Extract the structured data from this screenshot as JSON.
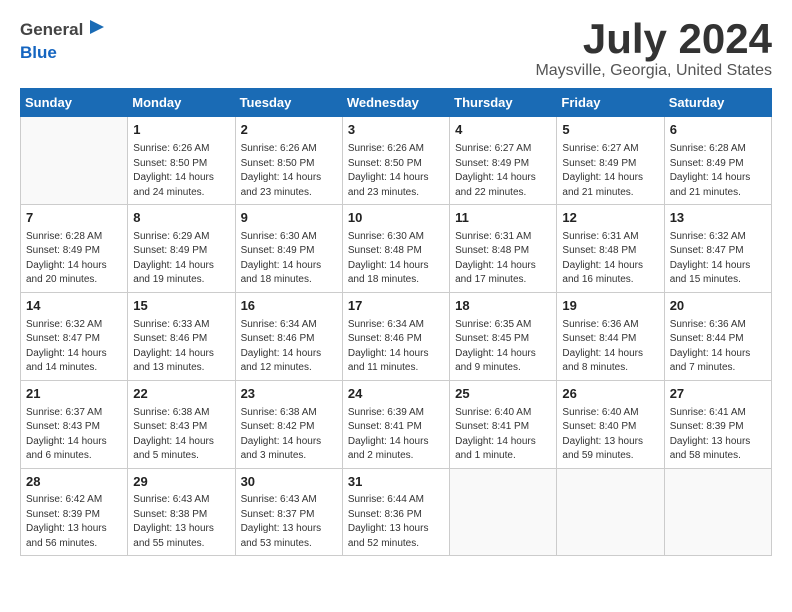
{
  "header": {
    "logo_line1": "General",
    "logo_line2": "Blue",
    "month": "July 2024",
    "location": "Maysville, Georgia, United States"
  },
  "days_of_week": [
    "Sunday",
    "Monday",
    "Tuesday",
    "Wednesday",
    "Thursday",
    "Friday",
    "Saturday"
  ],
  "weeks": [
    [
      {
        "day": "",
        "info": ""
      },
      {
        "day": "1",
        "info": "Sunrise: 6:26 AM\nSunset: 8:50 PM\nDaylight: 14 hours\nand 24 minutes."
      },
      {
        "day": "2",
        "info": "Sunrise: 6:26 AM\nSunset: 8:50 PM\nDaylight: 14 hours\nand 23 minutes."
      },
      {
        "day": "3",
        "info": "Sunrise: 6:26 AM\nSunset: 8:50 PM\nDaylight: 14 hours\nand 23 minutes."
      },
      {
        "day": "4",
        "info": "Sunrise: 6:27 AM\nSunset: 8:49 PM\nDaylight: 14 hours\nand 22 minutes."
      },
      {
        "day": "5",
        "info": "Sunrise: 6:27 AM\nSunset: 8:49 PM\nDaylight: 14 hours\nand 21 minutes."
      },
      {
        "day": "6",
        "info": "Sunrise: 6:28 AM\nSunset: 8:49 PM\nDaylight: 14 hours\nand 21 minutes."
      }
    ],
    [
      {
        "day": "7",
        "info": "Sunrise: 6:28 AM\nSunset: 8:49 PM\nDaylight: 14 hours\nand 20 minutes."
      },
      {
        "day": "8",
        "info": "Sunrise: 6:29 AM\nSunset: 8:49 PM\nDaylight: 14 hours\nand 19 minutes."
      },
      {
        "day": "9",
        "info": "Sunrise: 6:30 AM\nSunset: 8:49 PM\nDaylight: 14 hours\nand 18 minutes."
      },
      {
        "day": "10",
        "info": "Sunrise: 6:30 AM\nSunset: 8:48 PM\nDaylight: 14 hours\nand 18 minutes."
      },
      {
        "day": "11",
        "info": "Sunrise: 6:31 AM\nSunset: 8:48 PM\nDaylight: 14 hours\nand 17 minutes."
      },
      {
        "day": "12",
        "info": "Sunrise: 6:31 AM\nSunset: 8:48 PM\nDaylight: 14 hours\nand 16 minutes."
      },
      {
        "day": "13",
        "info": "Sunrise: 6:32 AM\nSunset: 8:47 PM\nDaylight: 14 hours\nand 15 minutes."
      }
    ],
    [
      {
        "day": "14",
        "info": "Sunrise: 6:32 AM\nSunset: 8:47 PM\nDaylight: 14 hours\nand 14 minutes."
      },
      {
        "day": "15",
        "info": "Sunrise: 6:33 AM\nSunset: 8:46 PM\nDaylight: 14 hours\nand 13 minutes."
      },
      {
        "day": "16",
        "info": "Sunrise: 6:34 AM\nSunset: 8:46 PM\nDaylight: 14 hours\nand 12 minutes."
      },
      {
        "day": "17",
        "info": "Sunrise: 6:34 AM\nSunset: 8:46 PM\nDaylight: 14 hours\nand 11 minutes."
      },
      {
        "day": "18",
        "info": "Sunrise: 6:35 AM\nSunset: 8:45 PM\nDaylight: 14 hours\nand 9 minutes."
      },
      {
        "day": "19",
        "info": "Sunrise: 6:36 AM\nSunset: 8:44 PM\nDaylight: 14 hours\nand 8 minutes."
      },
      {
        "day": "20",
        "info": "Sunrise: 6:36 AM\nSunset: 8:44 PM\nDaylight: 14 hours\nand 7 minutes."
      }
    ],
    [
      {
        "day": "21",
        "info": "Sunrise: 6:37 AM\nSunset: 8:43 PM\nDaylight: 14 hours\nand 6 minutes."
      },
      {
        "day": "22",
        "info": "Sunrise: 6:38 AM\nSunset: 8:43 PM\nDaylight: 14 hours\nand 5 minutes."
      },
      {
        "day": "23",
        "info": "Sunrise: 6:38 AM\nSunset: 8:42 PM\nDaylight: 14 hours\nand 3 minutes."
      },
      {
        "day": "24",
        "info": "Sunrise: 6:39 AM\nSunset: 8:41 PM\nDaylight: 14 hours\nand 2 minutes."
      },
      {
        "day": "25",
        "info": "Sunrise: 6:40 AM\nSunset: 8:41 PM\nDaylight: 14 hours\nand 1 minute."
      },
      {
        "day": "26",
        "info": "Sunrise: 6:40 AM\nSunset: 8:40 PM\nDaylight: 13 hours\nand 59 minutes."
      },
      {
        "day": "27",
        "info": "Sunrise: 6:41 AM\nSunset: 8:39 PM\nDaylight: 13 hours\nand 58 minutes."
      }
    ],
    [
      {
        "day": "28",
        "info": "Sunrise: 6:42 AM\nSunset: 8:39 PM\nDaylight: 13 hours\nand 56 minutes."
      },
      {
        "day": "29",
        "info": "Sunrise: 6:43 AM\nSunset: 8:38 PM\nDaylight: 13 hours\nand 55 minutes."
      },
      {
        "day": "30",
        "info": "Sunrise: 6:43 AM\nSunset: 8:37 PM\nDaylight: 13 hours\nand 53 minutes."
      },
      {
        "day": "31",
        "info": "Sunrise: 6:44 AM\nSunset: 8:36 PM\nDaylight: 13 hours\nand 52 minutes."
      },
      {
        "day": "",
        "info": ""
      },
      {
        "day": "",
        "info": ""
      },
      {
        "day": "",
        "info": ""
      }
    ]
  ]
}
